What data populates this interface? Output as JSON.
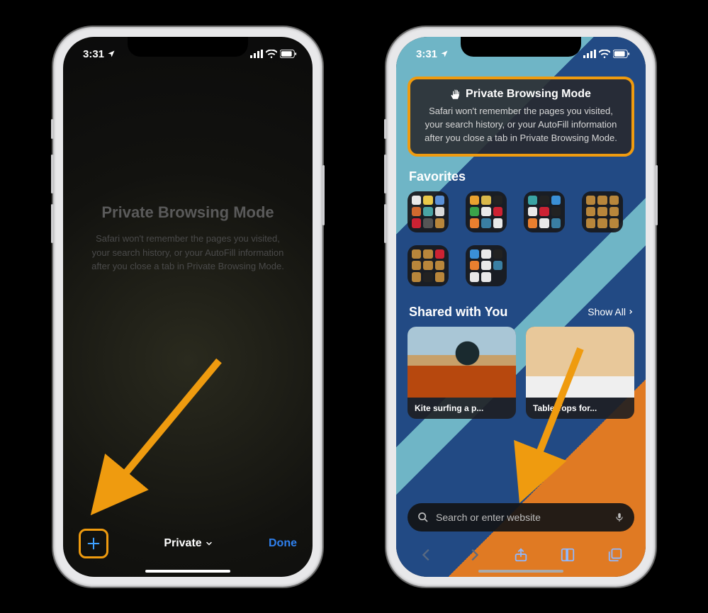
{
  "statusbar": {
    "time": "3:31",
    "location_icon": "location-arrow",
    "signal": 4,
    "wifi": 3,
    "battery": 85
  },
  "left_phone": {
    "pbm_title": "Private Browsing Mode",
    "pbm_body": "Safari won't remember the pages you visited, your search history, or your AutoFill information after you close a tab in Private Browsing Mode.",
    "tab_group_label": "Private",
    "done_label": "Done"
  },
  "right_phone": {
    "pbm_card_title": "Private Browsing Mode",
    "pbm_card_body": "Safari won't remember the pages you visited, your search history, or your AutoFill information after you close a tab in Private Browsing Mode.",
    "favorites_title": "Favorites",
    "shared_title": "Shared with You",
    "show_all_label": "Show All",
    "shared_items": [
      {
        "caption": "Kite surfing a p..."
      },
      {
        "caption": "Table Tops for..."
      }
    ],
    "search_placeholder": "Search or enter website"
  },
  "annotations": {
    "arrow_left_target": "new-tab-button",
    "arrow_right_target": "search-field"
  }
}
